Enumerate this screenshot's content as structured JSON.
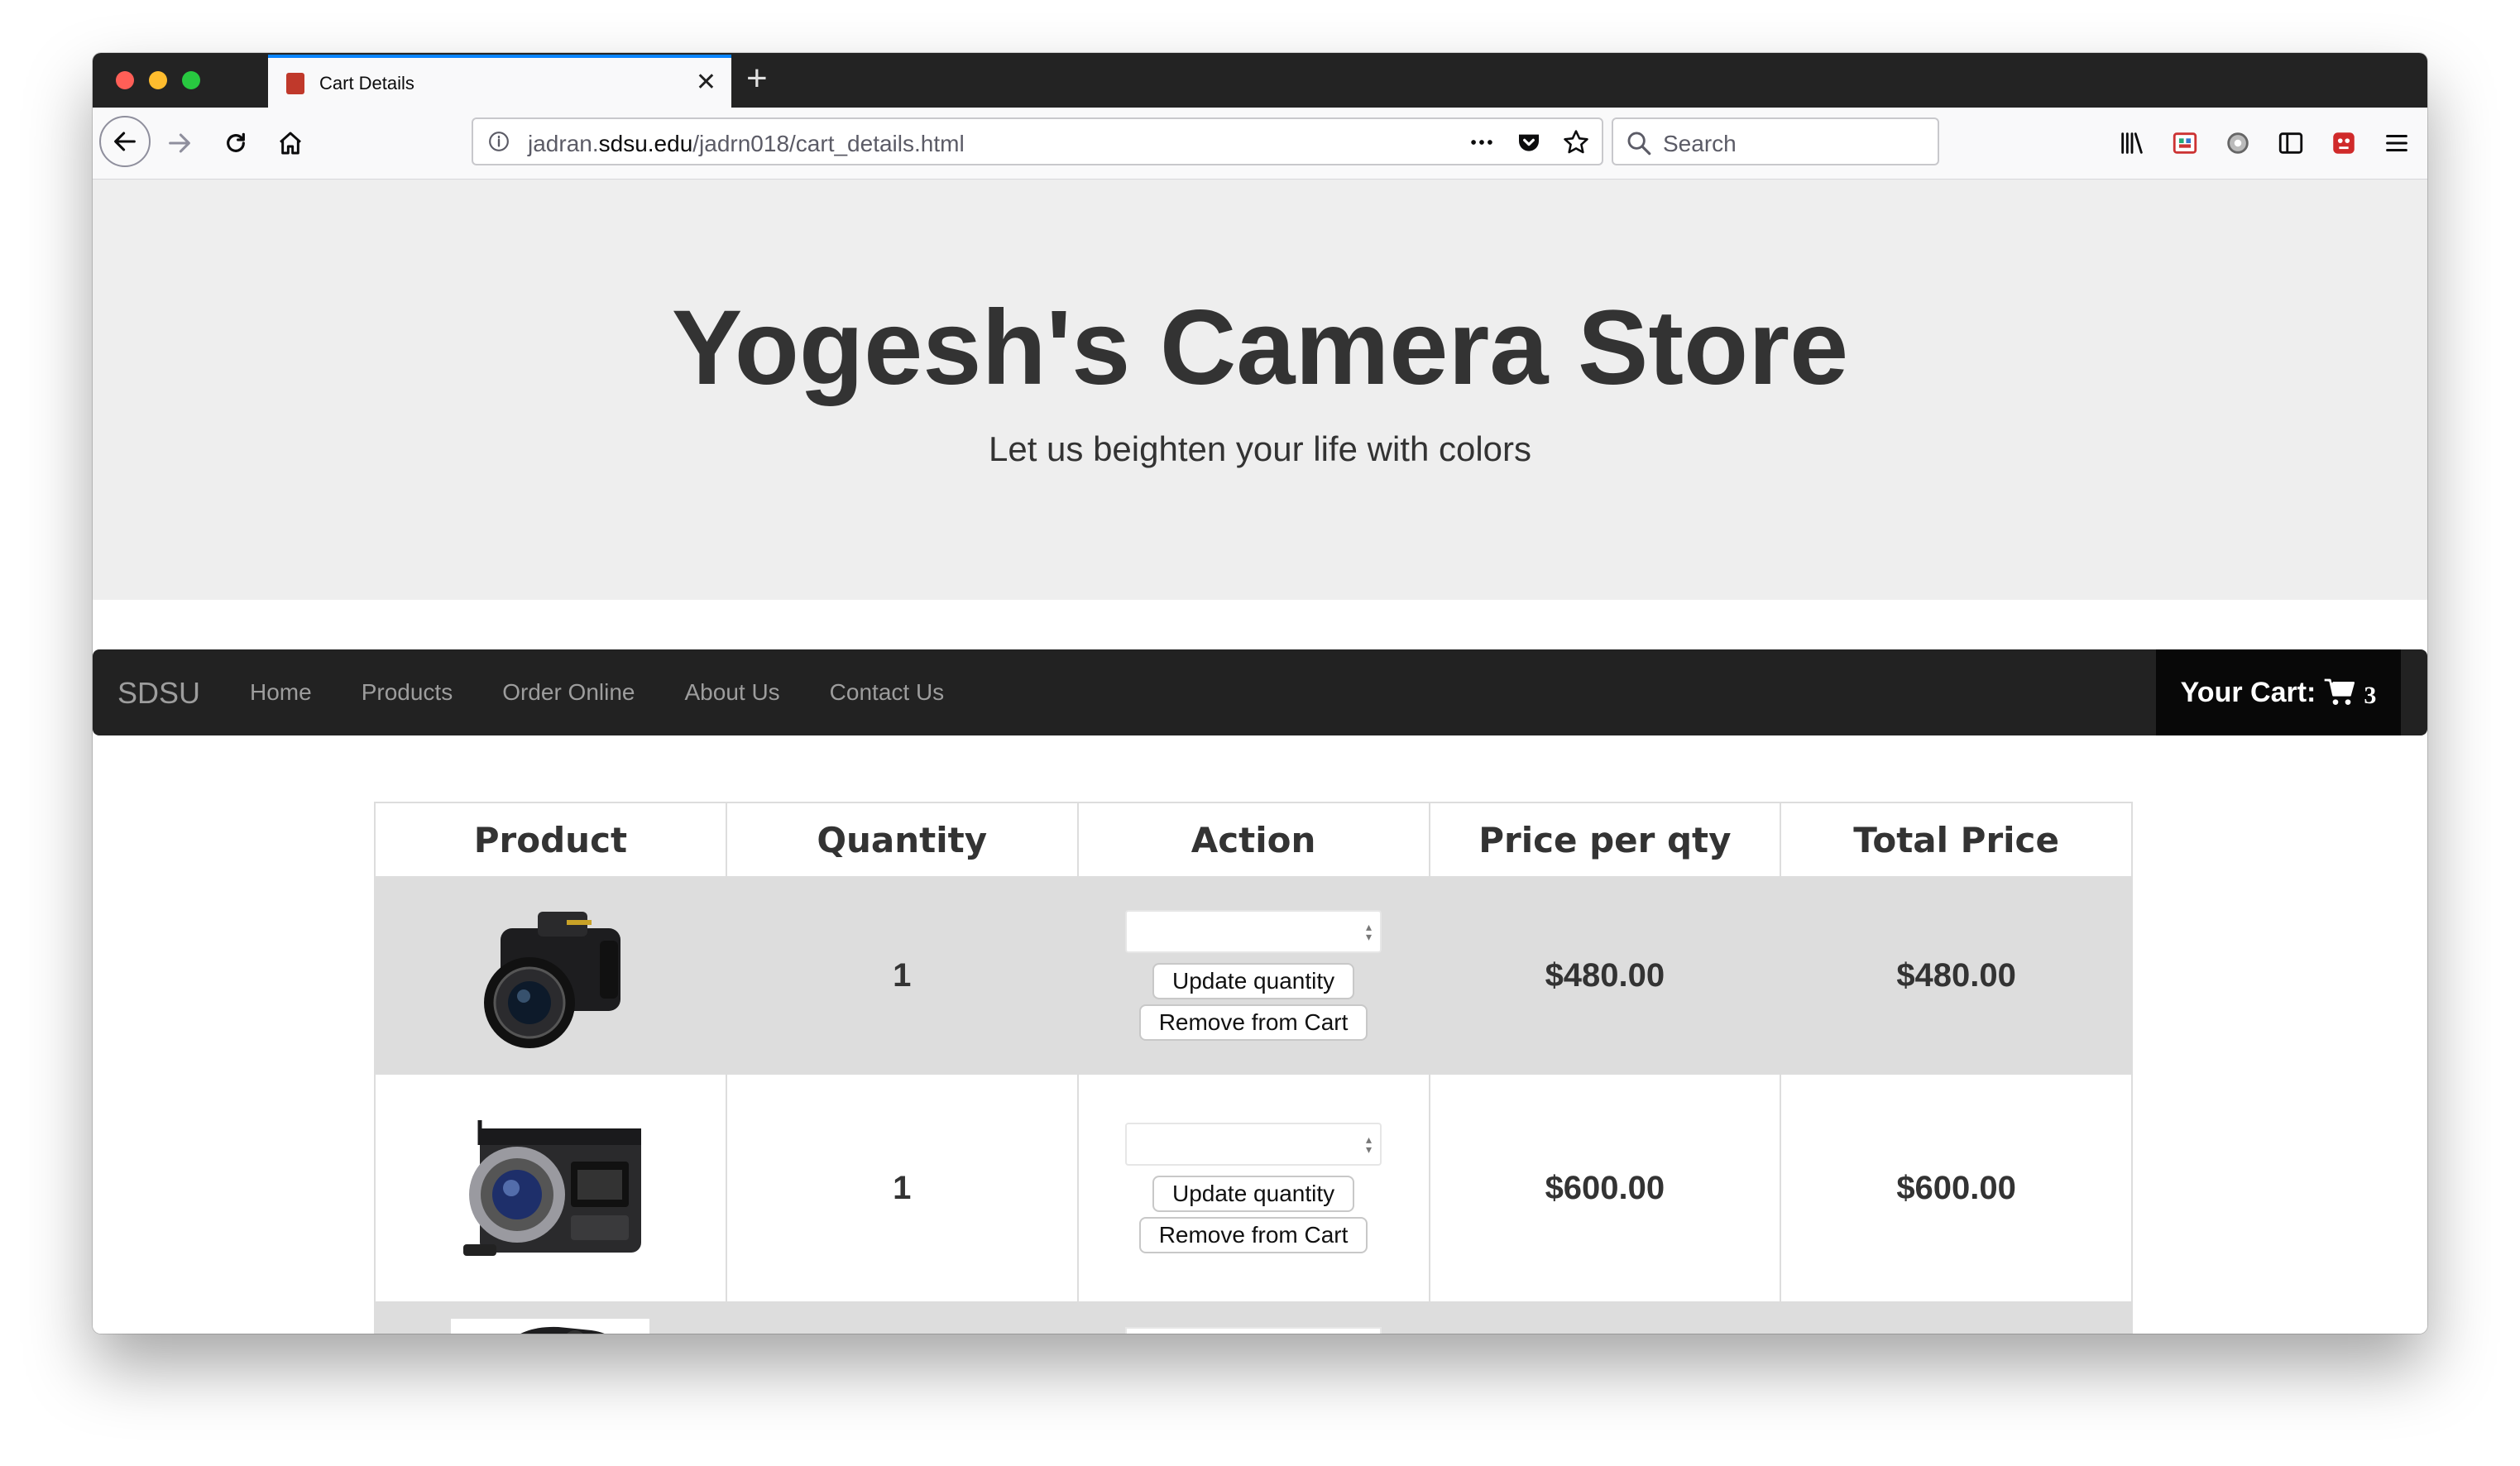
{
  "browser": {
    "tab_title": "Cart Details",
    "url_prefix": "jadran.",
    "url_host": "sdsu.edu",
    "url_path": "/jadrn018/cart_details.html",
    "search_placeholder": "Search",
    "accent_color": "#0a84ff"
  },
  "header": {
    "title": "Yogesh's Camera Store",
    "subtitle": "Let us beighten your life with colors"
  },
  "navbar": {
    "brand": "SDSU",
    "links": [
      "Home",
      "Products",
      "Order Online",
      "About Us",
      "Contact Us"
    ],
    "cart_label": "Your Cart:",
    "cart_count": "3"
  },
  "cart_table": {
    "headers": [
      "Product",
      "Quantity",
      "Action",
      "Price per qty",
      "Total Price"
    ],
    "update_label": "Update quantity",
    "remove_label": "Remove from Cart",
    "rows": [
      {
        "product_icon": "dslr-camera-image",
        "quantity": "1",
        "quantity_input": "",
        "price": "$480.00",
        "total": "$480.00"
      },
      {
        "product_icon": "cinema-camera-image",
        "quantity": "1",
        "quantity_input": "",
        "price": "$600.00",
        "total": "$600.00"
      }
    ]
  }
}
